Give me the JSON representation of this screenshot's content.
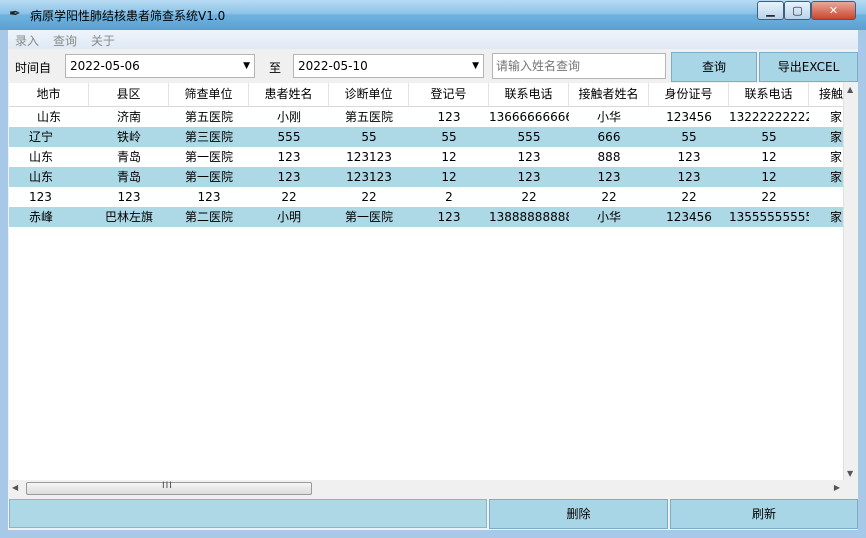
{
  "window": {
    "title": "病原学阳性肺结核患者筛查系统V1.0",
    "min_glyph": "▁",
    "max_glyph": "▢",
    "close_glyph": "✕"
  },
  "menu": [
    "录入",
    "查询",
    "关于"
  ],
  "toolbar": {
    "from_label": "时间自",
    "from_date": "2022-05-06",
    "to_label": "至",
    "to_date": "2022-05-10",
    "search_placeholder": "请输入姓名查询",
    "query_button": "查询",
    "export_button": "导出EXCEL"
  },
  "table": {
    "headers": [
      "地市",
      "县区",
      "筛查单位",
      "患者姓名",
      "诊断单位",
      "登记号",
      "联系电话",
      "接触者姓名",
      "身份证号",
      "联系电话",
      "接触"
    ],
    "rows": [
      [
        "山东",
        "济南",
        "第五医院",
        "小刚",
        "第五医院",
        "123",
        "13666666666",
        "小华",
        "123456",
        "13222222222",
        "家"
      ],
      [
        "辽宁",
        "铁岭",
        "第三医院",
        "555",
        "55",
        "55",
        "555",
        "666",
        "55",
        "55",
        "家"
      ],
      [
        "山东",
        "青岛",
        "第一医院",
        "123",
        "123123",
        "12",
        "123",
        "888",
        "123",
        "12",
        "家"
      ],
      [
        "山东",
        "青岛",
        "第一医院",
        "123",
        "123123",
        "12",
        "123",
        "123",
        "123",
        "12",
        "家"
      ],
      [
        "123",
        "123",
        "123",
        "22",
        "22",
        "2",
        "22",
        "22",
        "22",
        "22",
        ""
      ],
      [
        "赤峰",
        "巴林左旗",
        "第二医院",
        "小明",
        "第一医院",
        "123",
        "13888888888",
        "小华",
        "123456",
        "13555555555",
        "家"
      ]
    ]
  },
  "scroll": {
    "grip": "III",
    "up": "▲",
    "down": "▼",
    "left": "◀",
    "right": "▶"
  },
  "bottom": {
    "status_text": "",
    "delete_button": "删除",
    "refresh_button": "刷新"
  },
  "colors": {
    "accent_row": "#add8e6",
    "button": "#a8d6e6",
    "titlebar": "#8cc3e8"
  }
}
